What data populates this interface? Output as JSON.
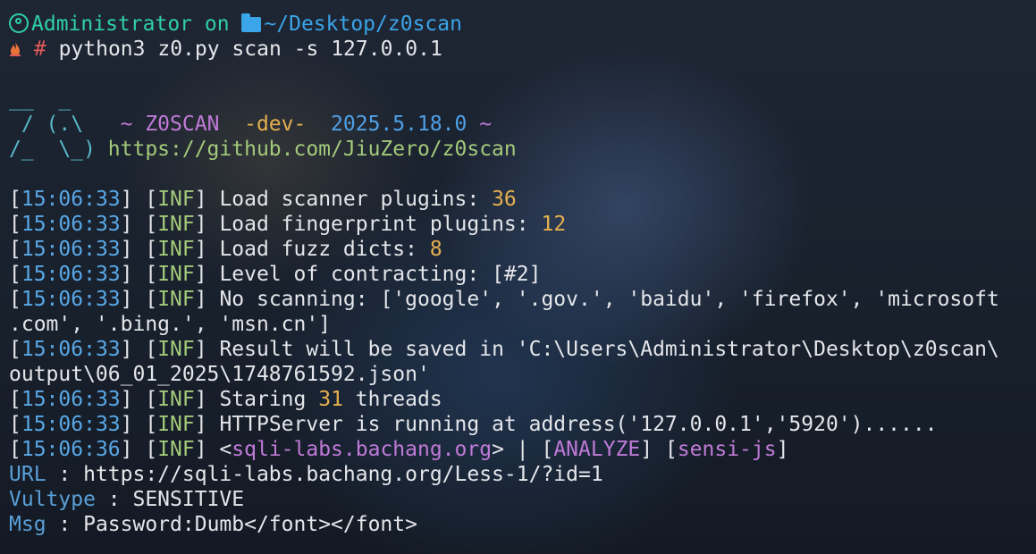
{
  "prompt": {
    "user": "Administrator",
    "on": " on ",
    "path": "~/Desktop/z0scan",
    "hash": "#",
    "command": " python3 z0.py scan -s 127.0.0.1"
  },
  "banner": {
    "line1": "__  _",
    "line2_left": " / (.\\   ",
    "tilde1": "~ ",
    "name": "Z0SCAN",
    "dev": "  -dev-  ",
    "version": "2025.5.18.0",
    "tilde2": " ~",
    "line3_left": "/_  \\_) ",
    "url": "https://github.com/JiuZero/z0scan"
  },
  "logs": [
    {
      "time": "15:06:33",
      "level": "INF",
      "text": "Load scanner plugins: ",
      "num": "36"
    },
    {
      "time": "15:06:33",
      "level": "INF",
      "text": "Load fingerprint plugins: ",
      "num": "12"
    },
    {
      "time": "15:06:33",
      "level": "INF",
      "text": "Load fuzz dicts: ",
      "num": "8"
    },
    {
      "time": "15:06:33",
      "level": "INF",
      "text": "Level of contracting: [#2]"
    },
    {
      "time": "15:06:33",
      "level": "INF",
      "text": "No scanning: ['google', '.gov.', 'baidu', 'firefox', 'microsoft",
      "cont": ".com', '.bing.', 'msn.cn']"
    },
    {
      "time": "15:06:33",
      "level": "INF",
      "text": "Result will be saved in 'C:\\Users\\Administrator\\Desktop\\z0scan\\",
      "cont": "output\\06_01_2025\\1748761592.json'"
    },
    {
      "time": "15:06:33",
      "level": "INF",
      "text": "Staring ",
      "num": "31",
      "after": " threads"
    },
    {
      "time": "15:06:33",
      "level": "INF",
      "text": "HTTPServer is running at address('127.0.0.1','5920')......"
    }
  ],
  "result": {
    "time": "15:06:36",
    "level": "INF",
    "host": "sqli-labs.bachang.org",
    "analyze": "ANALYZE",
    "plugin": "sensi-js"
  },
  "details": [
    {
      "key": "URL",
      "value": "https://sqli-labs.bachang.org/Less-1/?id=1"
    },
    {
      "key": "Vultype",
      "value": "SENSITIVE"
    },
    {
      "key": "Msg",
      "value": "Password:Dumb</font></font>"
    }
  ],
  "colors": {
    "user": "#2fd0a8",
    "path": "#3aa5e8",
    "time": "#59a8e6",
    "inf": "#a3c97a",
    "num": "#e6b04f",
    "purple": "#c07ad8"
  },
  "icons": [
    "user-circle-icon",
    "folder-icon",
    "flame-icon"
  ]
}
